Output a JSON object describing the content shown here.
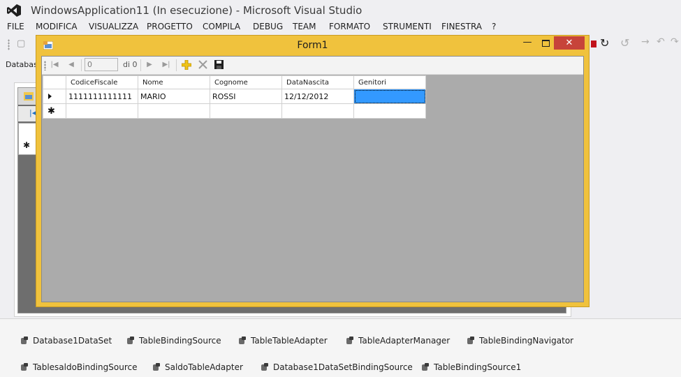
{
  "window": {
    "title": "WindowsApplication11 (In esecuzione) - Microsoft Visual Studio"
  },
  "menu": [
    "FILE",
    "MODIFICA",
    "VISUALIZZA",
    "PROGETTO",
    "COMPILA",
    "DEBUG",
    "TEAM",
    "FORMATO",
    "STRUMENTI",
    "FINESTRA",
    "?"
  ],
  "tab": {
    "label": "Databas"
  },
  "form1": {
    "title": "Form1",
    "minimize": "—",
    "close": "✕",
    "navigator": {
      "position_value": "0",
      "count_label": "di 0"
    },
    "grid": {
      "columns": [
        "CodiceFiscale",
        "Nome",
        "Cognome",
        "DataNascita",
        "Genitori"
      ],
      "rows": [
        [
          "1111111111111",
          "MARIO",
          "ROSSI",
          "12/12/2012",
          ""
        ]
      ],
      "new_row_marker": "✱"
    }
  },
  "tray": [
    "Database1DataSet",
    "TableBindingSource",
    "TableTableAdapter",
    "TableAdapterManager",
    "TableBindingNavigator",
    "TablesaldoBindingSource",
    "SaldoTableAdapter",
    "Database1DataSetBindingSource",
    "TableBindingSource1"
  ]
}
